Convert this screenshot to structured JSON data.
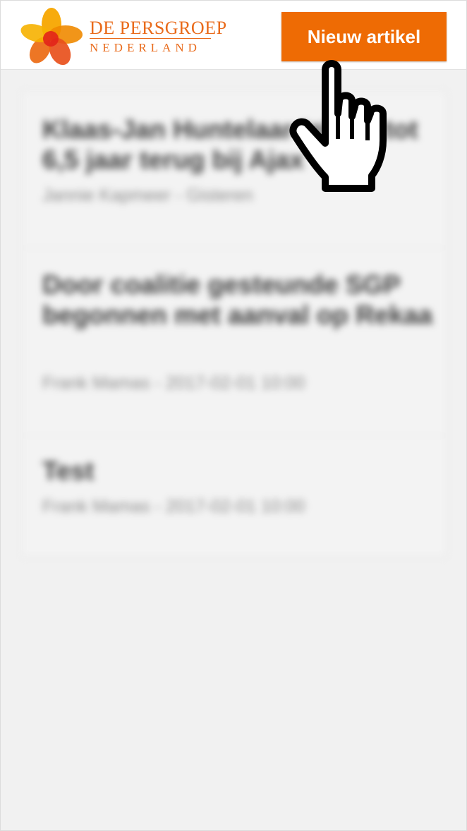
{
  "header": {
    "logo_line1": "DE PERSGROEP",
    "logo_line2": "NEDERLAND",
    "new_article_label": "Nieuw artikel"
  },
  "articles": [
    {
      "title": "Klaas-Jan Huntelaar tekent tot 6,5 jaar terug bij Ajax",
      "meta": "Jannie Kapmeer - Gisteren"
    },
    {
      "title": "Door coalitie gesteunde SGP begonnen met aanval op Rekaa",
      "meta": "Frank Mamas - 2017-02-01 10:00"
    },
    {
      "title": "Test",
      "meta": "Frank Mamas - 2017-02-01 10:00"
    }
  ],
  "colors": {
    "accent": "#ee6b04",
    "background": "#f1f1f1"
  },
  "icons": {
    "cursor": "pointing-hand-cursor-icon",
    "logo": "flower-logo-icon"
  }
}
